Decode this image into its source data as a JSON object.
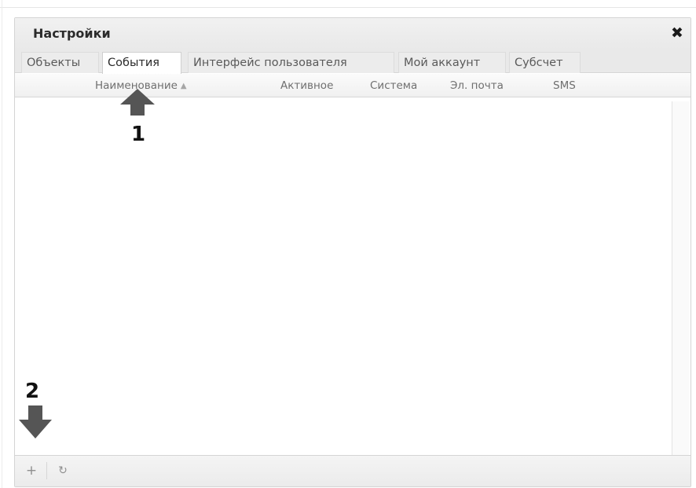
{
  "window": {
    "title": "Настройки",
    "close_label": "✖"
  },
  "tabs": [
    {
      "label": "Объекты",
      "active": false
    },
    {
      "label": "События",
      "active": true
    },
    {
      "label": "Интерфейс пользователя",
      "active": false
    },
    {
      "label": "Мой аккаунт",
      "active": false
    },
    {
      "label": "Субсчет",
      "active": false
    }
  ],
  "columns": {
    "name": "Наименование",
    "active": "Активное",
    "system": "Система",
    "email": "Эл. почта",
    "sms": "SMS"
  },
  "toolbar": {
    "add_label": "+",
    "refresh_label": "↻"
  },
  "annotations": {
    "callout_1": "1",
    "callout_2": "2"
  },
  "icons": {
    "sort": "sort-ascending-icon",
    "close": "close-icon",
    "add": "plus-icon",
    "refresh": "refresh-icon"
  },
  "colors": {
    "titlebar": "#ececec",
    "arrow": "#555555"
  }
}
